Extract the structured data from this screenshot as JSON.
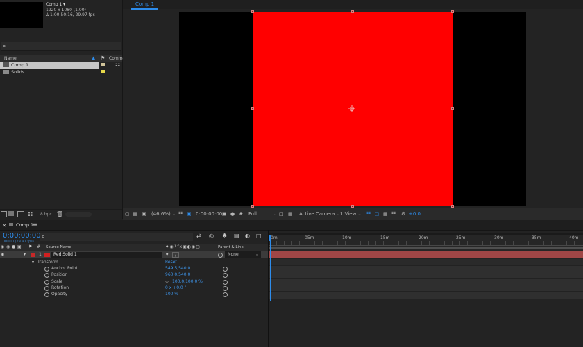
{
  "project": {
    "comp_name": "Comp 1",
    "info_lines": [
      "1920 x 1080 (1.00)",
      "Δ 1:00:50:16, 29.97 fps"
    ],
    "search_placeholder": "",
    "col_name": "Name",
    "col_comment": "Comme",
    "items": [
      {
        "label": "Comp 1",
        "selected": true,
        "swatch": "#cfc39a"
      },
      {
        "label": "Solids",
        "selected": false,
        "swatch": "#e6d84a"
      }
    ],
    "bpc": "8 bpc"
  },
  "viewer": {
    "tab_label": "Comp 1",
    "zoom": "(46.6%)",
    "timecode": "0:00:00:00",
    "resolution": "Full",
    "camera": "Active Camera",
    "views": "1 View",
    "exposure": "+0.0"
  },
  "timeline": {
    "tab_label": "Comp 1",
    "timecode": "0:00:00:00",
    "frame_info": "00000 (29.97 fps)",
    "col_source": "Source Name",
    "col_parent": "Parent & Link",
    "layer": {
      "number": "1",
      "name": "Red Solid 1",
      "parent": "None",
      "color": "#c62828"
    },
    "transform_label": "Transform",
    "reset_label": "Reset",
    "properties": [
      {
        "name": "Anchor Point",
        "value": "549.5,540.0"
      },
      {
        "name": "Position",
        "value": "960.0,540.0"
      },
      {
        "name": "Scale",
        "value": "100.0,100.0 %"
      },
      {
        "name": "Rotation",
        "value": "0 x +0.0 °"
      },
      {
        "name": "Opacity",
        "value": "100 %"
      }
    ],
    "ruler_labels": [
      "0m",
      "05m",
      "10m",
      "15m",
      "20m",
      "25m",
      "30m",
      "35m",
      "40m"
    ]
  },
  "colors": {
    "accent": "#2d8ceb",
    "solid": "#ff0000",
    "layer_bar": "#a04646",
    "workarea": "#4e4e4e"
  }
}
